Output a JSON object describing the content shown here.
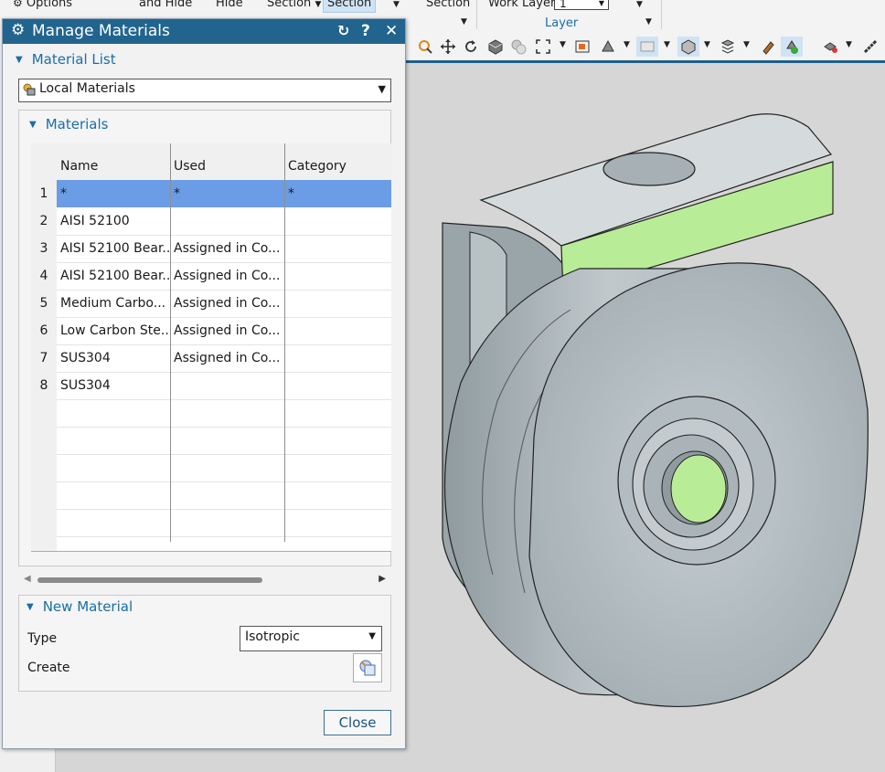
{
  "ribbon": {
    "options_label": "Options",
    "show_hide_label": "and Hide",
    "hide_label": "Hide",
    "section_dropdown_label": "Section",
    "section_active_label": "Section",
    "section2_label": "Section",
    "work_layer_label": "Work Layer",
    "work_layer_value": "1",
    "layer_group_label": "Layer"
  },
  "dialog": {
    "title": "Manage Materials",
    "material_list": {
      "section_title": "Material List",
      "selected_library": "Local Materials"
    },
    "materials": {
      "section_title": "Materials",
      "columns": [
        "Name",
        "Used",
        "Category"
      ],
      "rows": [
        {
          "num": "1",
          "name": "*",
          "used": "*",
          "category": "*"
        },
        {
          "num": "2",
          "name": "AISI 52100",
          "used": "",
          "category": ""
        },
        {
          "num": "3",
          "name": "AISI 52100 Bear...",
          "used": "Assigned in Co...",
          "category": ""
        },
        {
          "num": "4",
          "name": "AISI 52100 Bear...",
          "used": "Assigned in Co...",
          "category": ""
        },
        {
          "num": "5",
          "name": "Medium Carbo...",
          "used": "Assigned in Co...",
          "category": ""
        },
        {
          "num": "6",
          "name": "Low Carbon Ste...",
          "used": "Assigned in Co...",
          "category": ""
        },
        {
          "num": "7",
          "name": "SUS304",
          "used": "Assigned in Co...",
          "category": ""
        },
        {
          "num": "8",
          "name": "SUS304",
          "used": "",
          "category": ""
        }
      ]
    },
    "new_material": {
      "section_title": "New Material",
      "type_label": "Type",
      "type_value": "Isotropic",
      "create_label": "Create"
    },
    "close_label": "Close"
  },
  "colors": {
    "title_bar": "#21648e",
    "accent_text": "#1a6ea8",
    "selected_row": "#6a9de6",
    "highlight_face": "#b9ec97"
  }
}
